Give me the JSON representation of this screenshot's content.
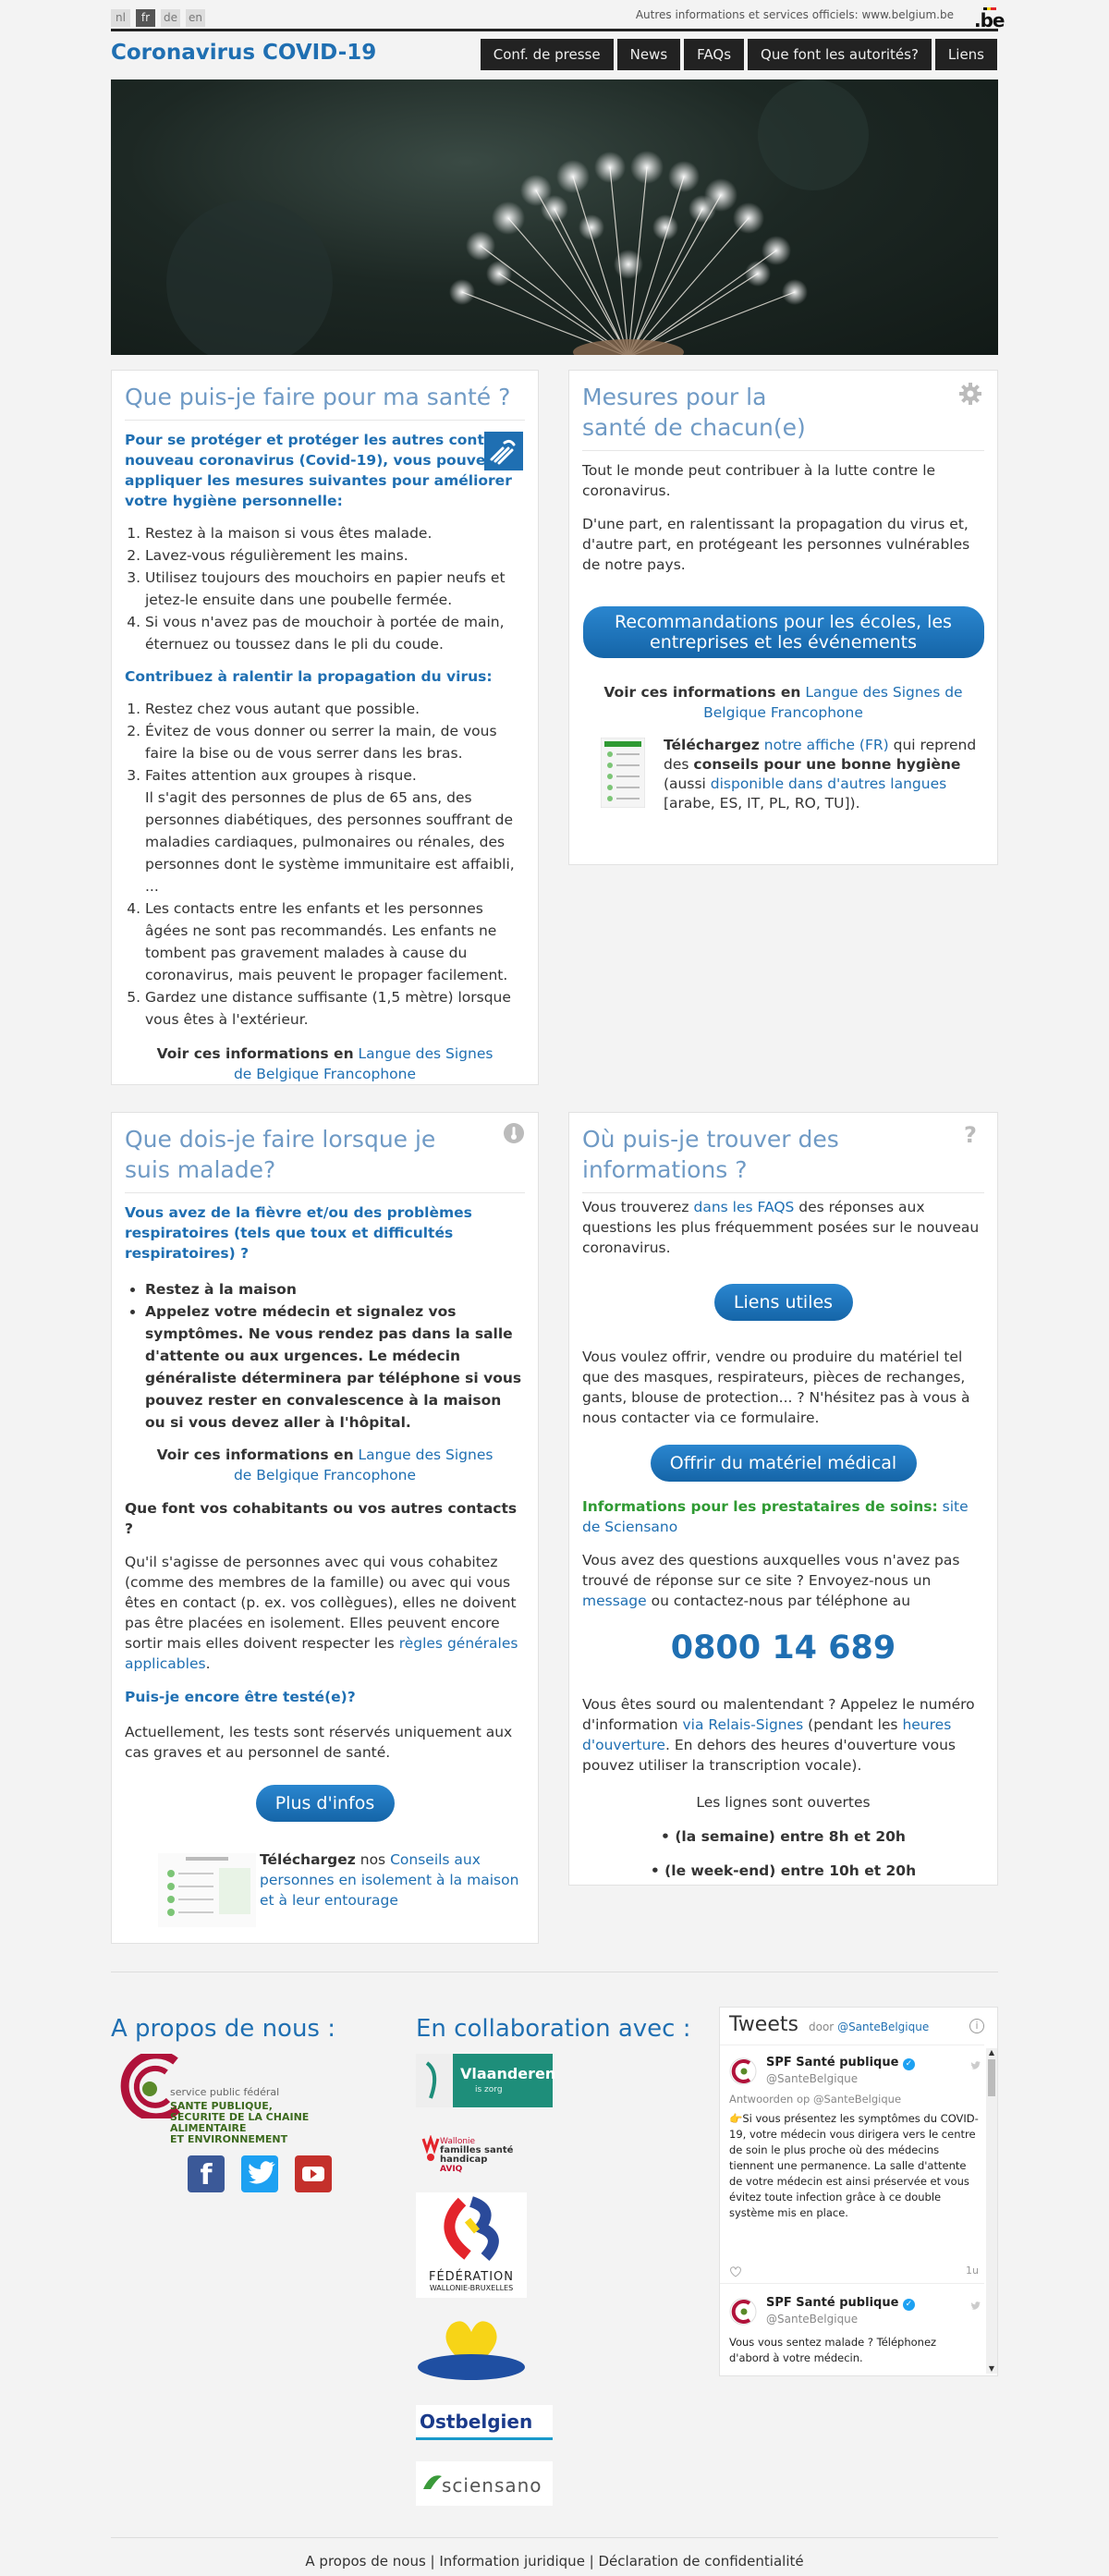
{
  "header": {
    "langs": [
      "nl",
      "fr",
      "de",
      "en"
    ],
    "official_info": "Autres informations et services officiels: www.belgium.be",
    "logo_text": ".be",
    "site_title": "Coronavirus COVID-19",
    "nav": [
      "Conf. de presse",
      "News",
      "FAQs",
      "Que font les autorités?",
      "Liens"
    ]
  },
  "health": {
    "title": "Que puis-je faire pour ma santé ?",
    "intro": "Pour se protéger et protéger les autres contre le nouveau coronavirus (Covid-19), vous pouvez appliquer les mesures suivantes pour améliorer votre hygiène personnelle:",
    "hygiene": [
      "Restez à la maison si vous êtes malade.",
      "Lavez-vous régulièrement les mains.",
      "Utilisez toujours des mouchoirs en papier neufs et jetez-le ensuite dans une poubelle fermée.",
      "Si vous n'avez pas de mouchoir à portée de main, éternuez ou toussez dans le pli du coude."
    ],
    "slow_title": "Contribuez à ralentir la propagation du virus:",
    "slow": [
      "Restez chez vous autant que possible.",
      "Évitez de vous donner ou serrer la main, de vous faire la bise ou de vous serrer dans les bras.",
      "Faites attention aux groupes à risque.",
      "Les contacts entre les enfants et les personnes âgées ne sont pas recommandés. Les enfants ne tombent pas gravement malades à cause du coronavirus, mais peuvent le propager facilement.",
      "Gardez une distance suffisante (1,5 mètre) lorsque vous êtes à l'extérieur."
    ],
    "risk_note": "Il s'agit des personnes de plus de 65 ans, des personnes diabétiques, des personnes souffrant de maladies cardiaques, pulmonaires ou rénales, des personnes dont le système immunitaire est affaibli, ...",
    "sign_prefix": "Voir ces informations en",
    "sign_link": "Langue des Signes de Belgique Francophone"
  },
  "measures": {
    "title": "Mesures pour la santé de chacun(e)",
    "p1": "Tout le monde peut contribuer à la lutte contre le coronavirus.",
    "p2": "D'une part, en ralentissant la propagation du virus et, d'autre part, en protégeant les personnes vulnérables de notre pays.",
    "button": "Recommandations pour les écoles, les entreprises et les événements",
    "sign_prefix": "Voir ces informations en",
    "sign_link": "Langue des Signes de Belgique Francophone",
    "dl_bold": "Téléchargez",
    "dl_link": "notre affiche (FR)",
    "dl_mid": "qui reprend des",
    "dl_bold2": "conseils pour une bonne hygiène",
    "dl_paren_open": "(aussi",
    "dl_link2": "disponible dans d'autres langues",
    "dl_tail": "[arabe, ES, IT, PL, RO, TU])."
  },
  "sick": {
    "title": "Que dois-je faire lorsque je suis malade?",
    "intro": "Vous avez de la fièvre et/ou des problèmes respiratoires (tels que toux et difficultés respiratoires) ?",
    "bullets": [
      "Restez à la maison",
      "Appelez votre médecin et signalez vos symptômes. Ne vous rendez pas dans la salle d'attente ou aux urgences. Le médecin généraliste déterminera par téléphone si vous pouvez rester en convalescence à la maison ou si vous devez aller à l'hôpital."
    ],
    "sign_prefix": "Voir ces informations en",
    "sign_link": "Langue des Signes de Belgique Francophone",
    "contacts_title": "Que font vos cohabitants ou vos autres contacts ?",
    "contacts_text": "Qu'il s'agisse de personnes avec qui vous cohabitez (comme des membres de la famille) ou avec qui vous êtes en contact (p. ex. vos collègues), elles ne doivent pas être placées en isolement. Elles peuvent encore sortir mais elles doivent respecter les",
    "contacts_link": "règles générales applicables",
    "test_title": "Puis-je encore être testé(e)?",
    "test_text": "Actuellement, les tests sont réservés uniquement aux cas graves et au personnel de santé.",
    "button": "Plus d'infos",
    "dl_bold": "Téléchargez",
    "dl_mid": "nos",
    "dl_link": "Conseils aux personnes en isolement à la maison et à leur entourage"
  },
  "where": {
    "title": "Où puis-je trouver des informations ?",
    "faq_pre": "Vous trouverez",
    "faq_link": "dans les FAQS",
    "faq_post": "des réponses aux questions les plus fréquemment posées sur le nouveau coronavirus.",
    "btn_links": "Liens utiles",
    "material": "Vous voulez offrir, vendre ou produire du matériel tel que des masques, respirateurs, pièces de rechanges, gants, blouse de protection... ? N'hésitez pas à vous à nous contacter via ce formulaire.",
    "btn_material": "Offrir du matériel médical",
    "providers_bold": "Informations pour les prestataires de soins:",
    "providers_link": "site de Sciensano",
    "q_pre": "Vous avez des questions auxquelles vous n'avez pas trouvé de réponse sur ce site ? Envoyez-nous un",
    "q_link": "message",
    "q_post": "ou contactez-nous par téléphone au",
    "phone": "0800 14 689",
    "deaf_pre": "Vous êtes sourd ou malentendant ? Appelez le numéro d'information",
    "deaf_link": "via Relais-Signes",
    "deaf_mid": "(pendant les",
    "deaf_link2": "heures d'ouverture",
    "deaf_post": ". En dehors des heures d'ouverture vous pouvez utiliser la transcription vocale).",
    "open": "Les lignes sont ouvertes",
    "week": "• (la semaine) entre 8h et 20h",
    "weekend": "• (le week-end) entre 10h et 20h"
  },
  "footer": {
    "about_title": "A propos de nous :",
    "spf_lines": [
      "service public fédéral",
      "SANTE PUBLIQUE,",
      "SECURITE DE LA CHAINE ALIMENTAIRE",
      "ET ENVIRONNEMENT"
    ],
    "collab_title": "En collaboration avec :",
    "partners": {
      "vlaanderen": "Vlaanderen",
      "vlaanderen_sub": "is zorg",
      "aviq_line1": "Wallonie",
      "aviq_line2": "familles santé handicap",
      "aviq_line3": "AVIQ",
      "fwb_line1": "FÉDÉRATION",
      "fwb_line2": "WALLONIE-BRUXELLES",
      "ostbelgien": "Ostbelgien",
      "sciensano": "sciensano"
    },
    "links": "A propos de nous | Information juridique | Déclaration de confidentialité"
  },
  "tweets": {
    "title": "Tweets",
    "by": "door",
    "handle_link": "@SanteBelgique",
    "items": [
      {
        "name": "SPF Santé publique",
        "handle": "@SanteBelgique",
        "reply": "Antwoorden op @SanteBelgique",
        "text": "👉Si vous présentez les symptômes du COVID-19, votre médecin vous dirigera vers le centre de soin le plus proche où des médecins tiennent une permanence. La salle d'attente de votre médecin est ainsi préservée et vous évitez toute infection grâce à ce double système mis en place.",
        "time": "1u"
      },
      {
        "name": "SPF Santé publique",
        "handle": "@SanteBelgique",
        "text": "Vous vous sentez malade ? Téléphonez d'abord à votre médecin."
      }
    ]
  },
  "colors": {
    "accent": "#1f6fb2",
    "heading": "#6f9ac5",
    "provider_green": "#2f9a33"
  }
}
